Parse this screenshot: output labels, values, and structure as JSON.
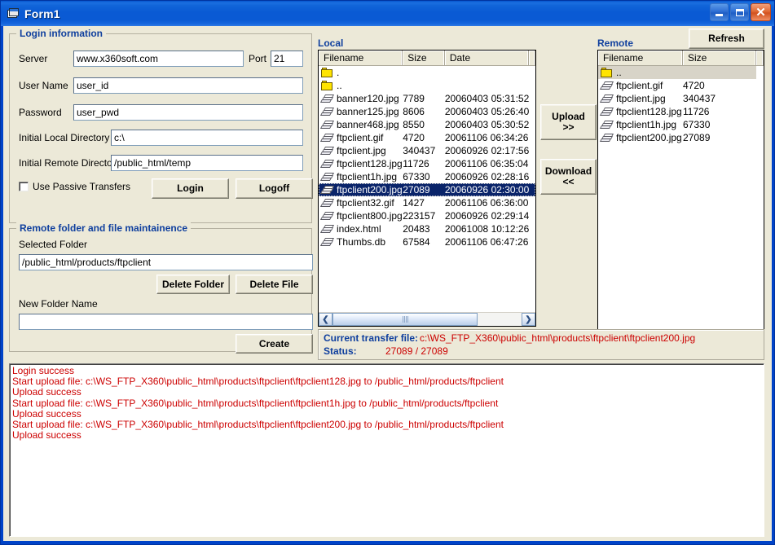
{
  "window": {
    "title": "Form1",
    "icon": "form-icon",
    "minimize_label": "_",
    "maximize_label": "□",
    "close_label": "✕",
    "accent_title_color": "#0a5ad4",
    "client_bg": "#ece9d8"
  },
  "login_group": {
    "title": "Login information",
    "server_label": "Server",
    "server_value": "www.x360soft.com",
    "port_label": "Port",
    "port_value": "21",
    "username_label": "User Name",
    "username_value": "user_id",
    "password_label": "Password",
    "password_value": "user_pwd",
    "local_dir_label": "Initial Local Directory",
    "local_dir_value": "c:\\",
    "remote_dir_label": "Initial Remote Directory",
    "remote_dir_value": "/public_html/temp",
    "passive_label": "Use Passive Transfers",
    "passive_checked": false,
    "login_button": "Login",
    "logoff_button": "Logoff"
  },
  "maintenance_group": {
    "title": "Remote folder and file maintainence",
    "selected_folder_label": "Selected Folder",
    "selected_folder_value": "/public_html/products/ftpclient",
    "delete_folder_button": "Delete Folder",
    "delete_file_button": "Delete File",
    "new_folder_label": "New Folder Name",
    "new_folder_value": "",
    "create_button": "Create"
  },
  "local_panel": {
    "title": "Local",
    "columns": [
      "Filename",
      "Size",
      "Date"
    ],
    "rows": [
      {
        "icon": "folder-icon",
        "name": ".",
        "size": "",
        "date": "",
        "selected": false
      },
      {
        "icon": "folder-icon",
        "name": "..",
        "size": "",
        "date": "",
        "selected": false
      },
      {
        "icon": "file-icon",
        "name": "banner120.jpg",
        "size": "7789",
        "date": "20060403 05:31:52",
        "selected": false
      },
      {
        "icon": "file-icon",
        "name": "banner125.jpg",
        "size": "8606",
        "date": "20060403 05:26:40",
        "selected": false
      },
      {
        "icon": "file-icon",
        "name": "banner468.jpg",
        "size": "8550",
        "date": "20060403 05:30:52",
        "selected": false
      },
      {
        "icon": "file-icon",
        "name": "ftpclient.gif",
        "size": "4720",
        "date": "20061106 06:34:26",
        "selected": false
      },
      {
        "icon": "file-icon",
        "name": "ftpclient.jpg",
        "size": "340437",
        "date": "20060926 02:17:56",
        "selected": false
      },
      {
        "icon": "file-icon",
        "name": "ftpclient128.jpg",
        "size": "11726",
        "date": "20061106 06:35:04",
        "selected": false
      },
      {
        "icon": "file-icon",
        "name": "ftpclient1h.jpg",
        "size": "67330",
        "date": "20060926 02:28:16",
        "selected": false
      },
      {
        "icon": "file-icon",
        "name": "ftpclient200.jpg",
        "size": "27089",
        "date": "20060926 02:30:00",
        "selected": true
      },
      {
        "icon": "file-icon",
        "name": "ftpclient32.gif",
        "size": "1427",
        "date": "20061106 06:36:00",
        "selected": false
      },
      {
        "icon": "file-icon",
        "name": "ftpclient800.jpg",
        "size": "223157",
        "date": "20060926 02:29:14",
        "selected": false
      },
      {
        "icon": "file-icon",
        "name": "index.html",
        "size": "20483",
        "date": "20061008 10:12:26",
        "selected": false
      },
      {
        "icon": "file-icon",
        "name": "Thumbs.db",
        "size": "67584",
        "date": "20061106 06:47:26",
        "selected": false
      }
    ],
    "scroll_left_icon": "chevron-left-icon",
    "scroll_right_icon": "chevron-right-icon"
  },
  "transfer_buttons": {
    "upload_label": "Upload",
    "upload_arrows": ">>",
    "download_label": "Download",
    "download_arrows": "<<"
  },
  "remote_panel": {
    "title": "Remote",
    "refresh_button": "Refresh",
    "columns": [
      "Filename",
      "Size"
    ],
    "rows": [
      {
        "icon": "folder-icon",
        "name": "..",
        "size": "",
        "selected_inactive": true
      },
      {
        "icon": "file-icon",
        "name": "ftpclient.gif",
        "size": "4720",
        "selected_inactive": false
      },
      {
        "icon": "file-icon",
        "name": "ftpclient.jpg",
        "size": "340437",
        "selected_inactive": false
      },
      {
        "icon": "file-icon",
        "name": "ftpclient128.jpg",
        "size": "11726",
        "selected_inactive": false
      },
      {
        "icon": "file-icon",
        "name": "ftpclient1h.jpg",
        "size": "67330",
        "selected_inactive": false
      },
      {
        "icon": "file-icon",
        "name": "ftpclient200.jpg",
        "size": "27089",
        "selected_inactive": false
      }
    ]
  },
  "status_panel": {
    "current_transfer_label": "Current transfer file:",
    "current_transfer_value": "c:\\WS_FTP_X360\\public_html\\products\\ftpclient\\ftpclient200.jpg",
    "status_label": "Status:",
    "status_value": "27089 / 27089",
    "text_color": "#cc0000",
    "label_color": "#0f3f9e"
  },
  "log": {
    "text_color": "#cc0000",
    "lines": [
      "Login success",
      "Start upload file: c:\\WS_FTP_X360\\public_html\\products\\ftpclient\\ftpclient128.jpg to /public_html/products/ftpclient",
      "Upload success",
      "Start upload file: c:\\WS_FTP_X360\\public_html\\products\\ftpclient\\ftpclient1h.jpg to /public_html/products/ftpclient",
      "Upload success",
      "Start upload file: c:\\WS_FTP_X360\\public_html\\products\\ftpclient\\ftpclient200.jpg to /public_html/products/ftpclient",
      "Upload success"
    ]
  }
}
